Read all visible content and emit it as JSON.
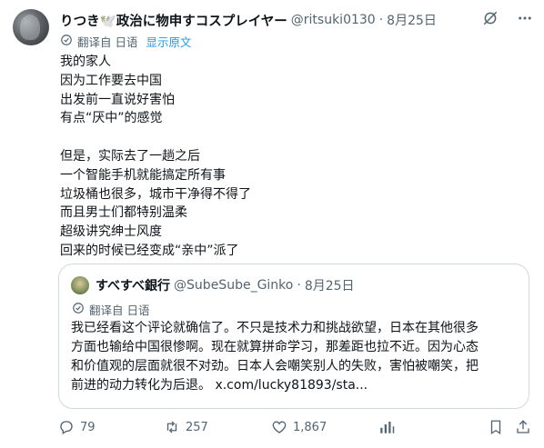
{
  "tweet": {
    "display_name": "りつき🕊️政治に物申すコスプレイヤー",
    "handle": "@ritsuki0130",
    "separator": "·",
    "date": "8月25日",
    "translate_label": "翻译自 日语",
    "show_original": "显示原文",
    "lines": [
      "我的家人",
      "因为工作要去中国",
      "出发前一直说好害怕",
      "有点“厌中”的感觉",
      "",
      "但是，实际去了一趟之后",
      "一个智能手机就能搞定所有事",
      "垃圾桶也很多，城市干净得不得了",
      "而且男士们都特别温柔",
      "超级讲究绅士风度",
      "回来的时候已经变成“亲中”派了"
    ]
  },
  "quote": {
    "display_name": "すべすべ銀行",
    "handle": "@SubeSube_Ginko",
    "separator": "·",
    "date": "8月25日",
    "translate_label": "翻译自 日语",
    "lines": [
      "我已经看这个评论就确信了。不只是技术力和挑战欲望，日本在其他很多",
      "方面也输给中国很惨啊。现在就算拼命学习，那差距也拉不近。因为心态",
      "和价值观的层面就很不对劲。日本人会嘲笑别人的失败，害怕被嘲笑，把",
      "前进的动力转化为后退。 x.com/lucky81893/sta..."
    ]
  },
  "actions": {
    "replies": "79",
    "retweets": "257",
    "likes": "1,867"
  },
  "icons": {
    "header": [
      "grok-icon",
      "more-icon"
    ],
    "translate": "translate-icon",
    "actions": [
      "reply-icon",
      "retweet-icon",
      "like-icon",
      "views-icon",
      "bookmark-icon",
      "share-icon"
    ]
  },
  "colors": {
    "text": "#0f1419",
    "muted": "#536471",
    "link": "#1d9bf0",
    "border": "#cfd9de"
  }
}
